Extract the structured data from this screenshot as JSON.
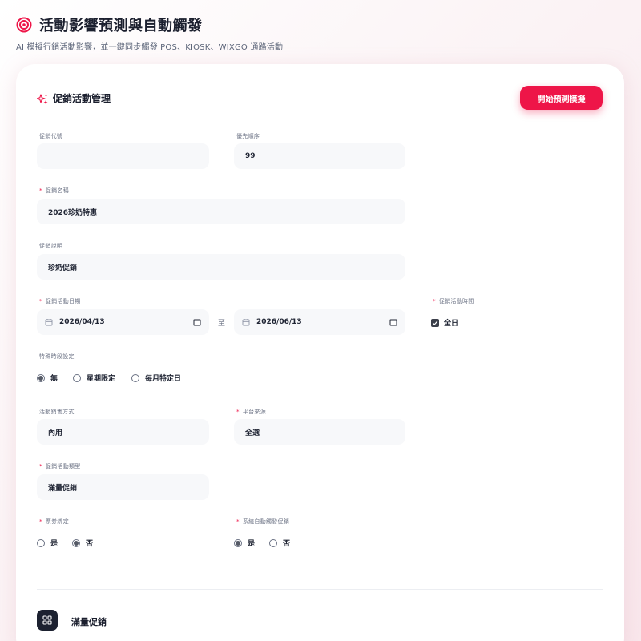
{
  "header": {
    "title": "活動影響預測與自動觸發",
    "subtitle": "AI 模擬行銷活動影響，並一鍵同步觸發 POS、KIOSK、WIXGO 通路活動",
    "icon": "target-icon",
    "accent": "#ee1548"
  },
  "card": {
    "title": "促銷活動管理",
    "title_icon": "sparkle-icon",
    "primary_button": "開始預測模擬"
  },
  "form": {
    "promo_code": {
      "label": "促銷代號",
      "value": ""
    },
    "priority": {
      "label": "優先順序",
      "value": "99"
    },
    "promo_name": {
      "label": "促銷名稱",
      "required": "*",
      "value": "2026珍奶特惠"
    },
    "description": {
      "label": "促銷說明",
      "value": "珍奶促銷"
    },
    "date_range": {
      "label": "促銷活動日期",
      "required": "*",
      "start": "2026/04/13",
      "separator": "至",
      "end": "2026/06/13"
    },
    "time": {
      "label": "促銷活動時間",
      "required": "*",
      "all_day_label": "全日",
      "all_day_checked": true
    },
    "special_period": {
      "label": "特殊時段設定",
      "options": [
        "無",
        "星期限定",
        "每月特定日"
      ],
      "selected": "無"
    },
    "sales_method": {
      "label": "活動銷售方式",
      "value": "內用"
    },
    "platform": {
      "label": "平台來源",
      "required": "*",
      "value": "全選"
    },
    "promo_type": {
      "label": "促銷活動類型",
      "required": "*",
      "value": "滿量促銷"
    },
    "coupon_bind": {
      "label": "票券綁定",
      "required": "*",
      "options": [
        "是",
        "否"
      ],
      "selected": "否"
    },
    "auto_trigger": {
      "label": "系統自動觸發促銷",
      "required": "*",
      "options": [
        "是",
        "否"
      ],
      "selected": "是"
    }
  },
  "section": {
    "title": "滿量促銷",
    "icon": "grid-icon"
  }
}
